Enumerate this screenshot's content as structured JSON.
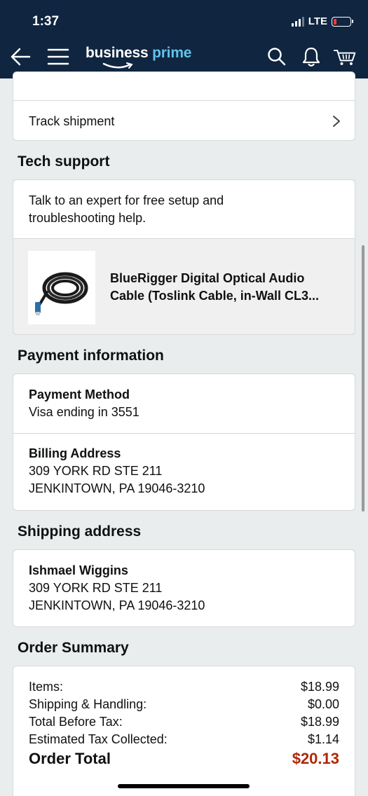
{
  "status_bar": {
    "time": "1:37",
    "network": "LTE"
  },
  "header": {
    "logo_business": "business",
    "logo_prime": "prime"
  },
  "track": {
    "label": "Track shipment"
  },
  "tech_support": {
    "title": "Tech support",
    "description": "Talk to an expert for free setup and troubleshooting help.",
    "product_name": "BlueRigger Digital Optical Audio Cable (Toslink Cable, in-Wall CL3..."
  },
  "payment": {
    "title": "Payment information",
    "method_label": "Payment Method",
    "method_value": "Visa ending in 3551",
    "billing_label": "Billing Address",
    "billing_line1": "309 YORK RD STE 211",
    "billing_line2": "JENKINTOWN, PA 19046-3210"
  },
  "shipping": {
    "title": "Shipping address",
    "name": "Ishmael Wiggins",
    "line1": "309 YORK RD STE 211",
    "line2": "JENKINTOWN, PA 19046-3210"
  },
  "summary": {
    "title": "Order Summary",
    "rows": [
      {
        "label": "Items:",
        "value": "$18.99"
      },
      {
        "label": "Shipping & Handling:",
        "value": "$0.00"
      },
      {
        "label": "Total Before Tax:",
        "value": "$18.99"
      },
      {
        "label": "Estimated Tax Collected:",
        "value": "$1.14"
      }
    ],
    "total_label": "Order Total",
    "total_value": "$20.13"
  },
  "colors": {
    "header_bg": "#0f2540",
    "prime_blue": "#5fc3ea",
    "total_red": "#b12704"
  }
}
